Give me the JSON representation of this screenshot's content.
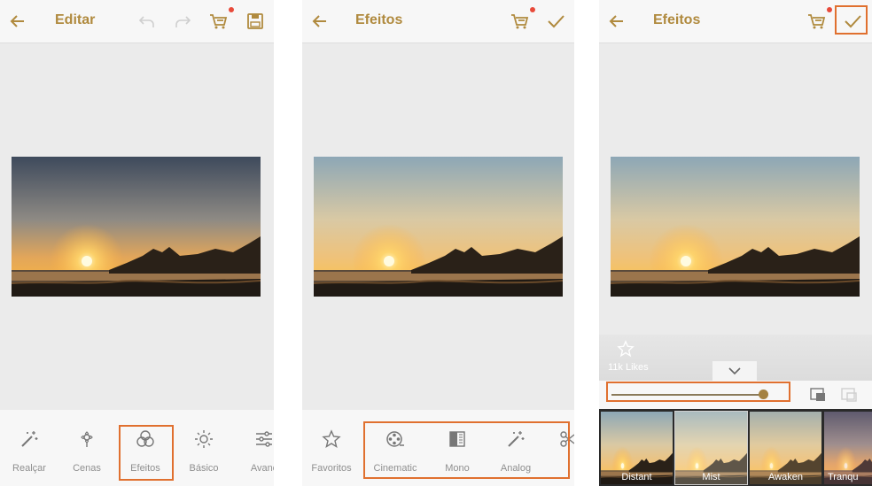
{
  "panel1": {
    "title": "Editar",
    "tools": [
      {
        "label": "Realçar",
        "icon": "magic-wand-icon"
      },
      {
        "label": "Cenas",
        "icon": "scene-flower-icon"
      },
      {
        "label": "Efeitos",
        "icon": "effects-circles-icon"
      },
      {
        "label": "Básico",
        "icon": "brightness-sun-icon"
      },
      {
        "label": "Avanç",
        "icon": "sliders-icon"
      }
    ]
  },
  "panel2": {
    "title": "Efeitos",
    "categories": [
      {
        "label": "Favoritos",
        "icon": "star-icon"
      },
      {
        "label": "Cinematic",
        "icon": "film-reel-icon"
      },
      {
        "label": "Mono",
        "icon": "mono-bw-icon"
      },
      {
        "label": "Analog",
        "icon": "magic-wand-icon"
      }
    ]
  },
  "panel3": {
    "title": "Efeitos",
    "likes": "11k Likes",
    "filters": [
      {
        "label": "Distant"
      },
      {
        "label": "Mist"
      },
      {
        "label": "Awaken"
      },
      {
        "label": "Tranqu"
      }
    ],
    "selected_filter": "Mist",
    "intensity": 0.93
  },
  "colors": {
    "accent": "#b08a3e",
    "highlight": "#e0702f",
    "badge": "#e84a3a"
  }
}
